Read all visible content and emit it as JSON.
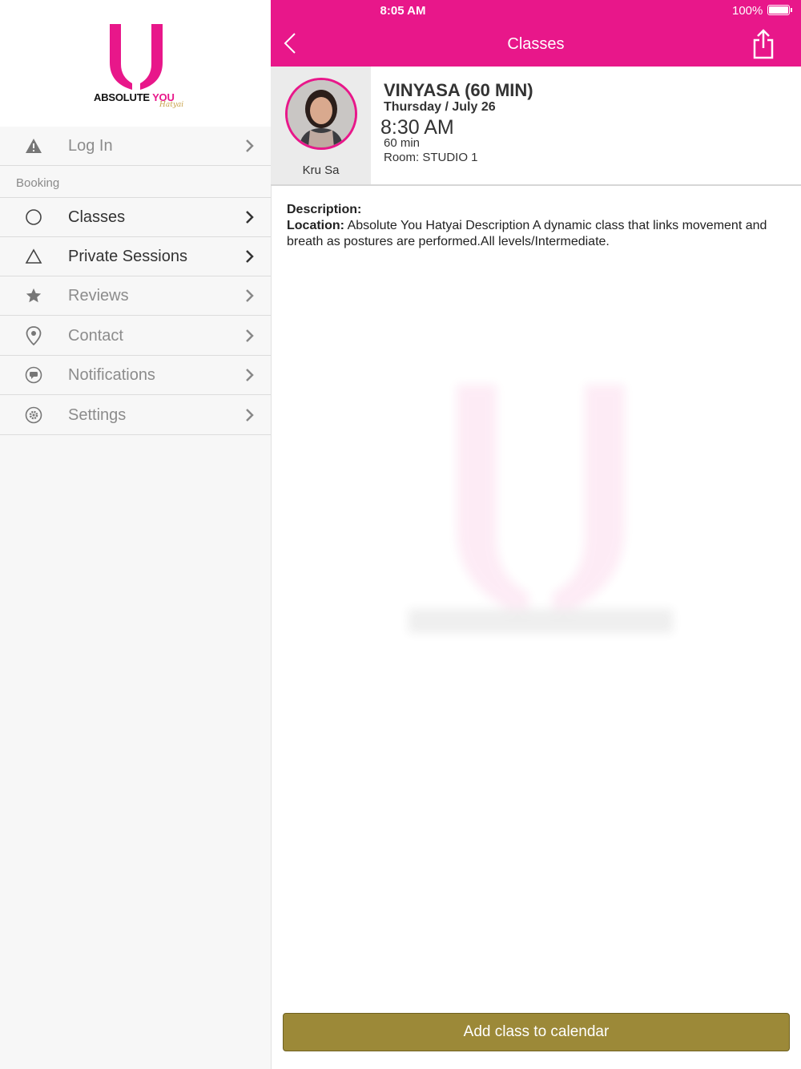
{
  "status": {
    "time": "8:05 AM",
    "battery": "100%"
  },
  "logo": {
    "brand_main": "ABSOLUTE ",
    "brand_accent": "YOU",
    "brand_script": "Hatyai"
  },
  "sidebar": {
    "login_label": "Log In",
    "section_label": "Booking",
    "items": [
      {
        "label": "Classes",
        "icon": "circle-icon"
      },
      {
        "label": "Private Sessions",
        "icon": "triangle-icon"
      },
      {
        "label": "Reviews",
        "icon": "star-icon"
      },
      {
        "label": "Contact",
        "icon": "location-pin-icon"
      },
      {
        "label": "Notifications",
        "icon": "chat-bubble-icon"
      },
      {
        "label": "Settings",
        "icon": "gear-icon"
      }
    ]
  },
  "header": {
    "title": "Classes"
  },
  "class_info": {
    "title": "VINYASA (60 MIN)",
    "date": "Thursday / July 26",
    "time": "8:30 AM",
    "duration": "60 min",
    "room": "Room: STUDIO 1",
    "instructor": "Kru Sa"
  },
  "description": {
    "heading": "Description:",
    "location_label": "Location:",
    "text": " Absolute You Hatyai Description A dynamic class that links movement and breath as postures are performed.All levels/Intermediate."
  },
  "cta": {
    "label": "Add class to calendar"
  },
  "colors": {
    "accent": "#e8178a",
    "cta": "#9c8938"
  }
}
